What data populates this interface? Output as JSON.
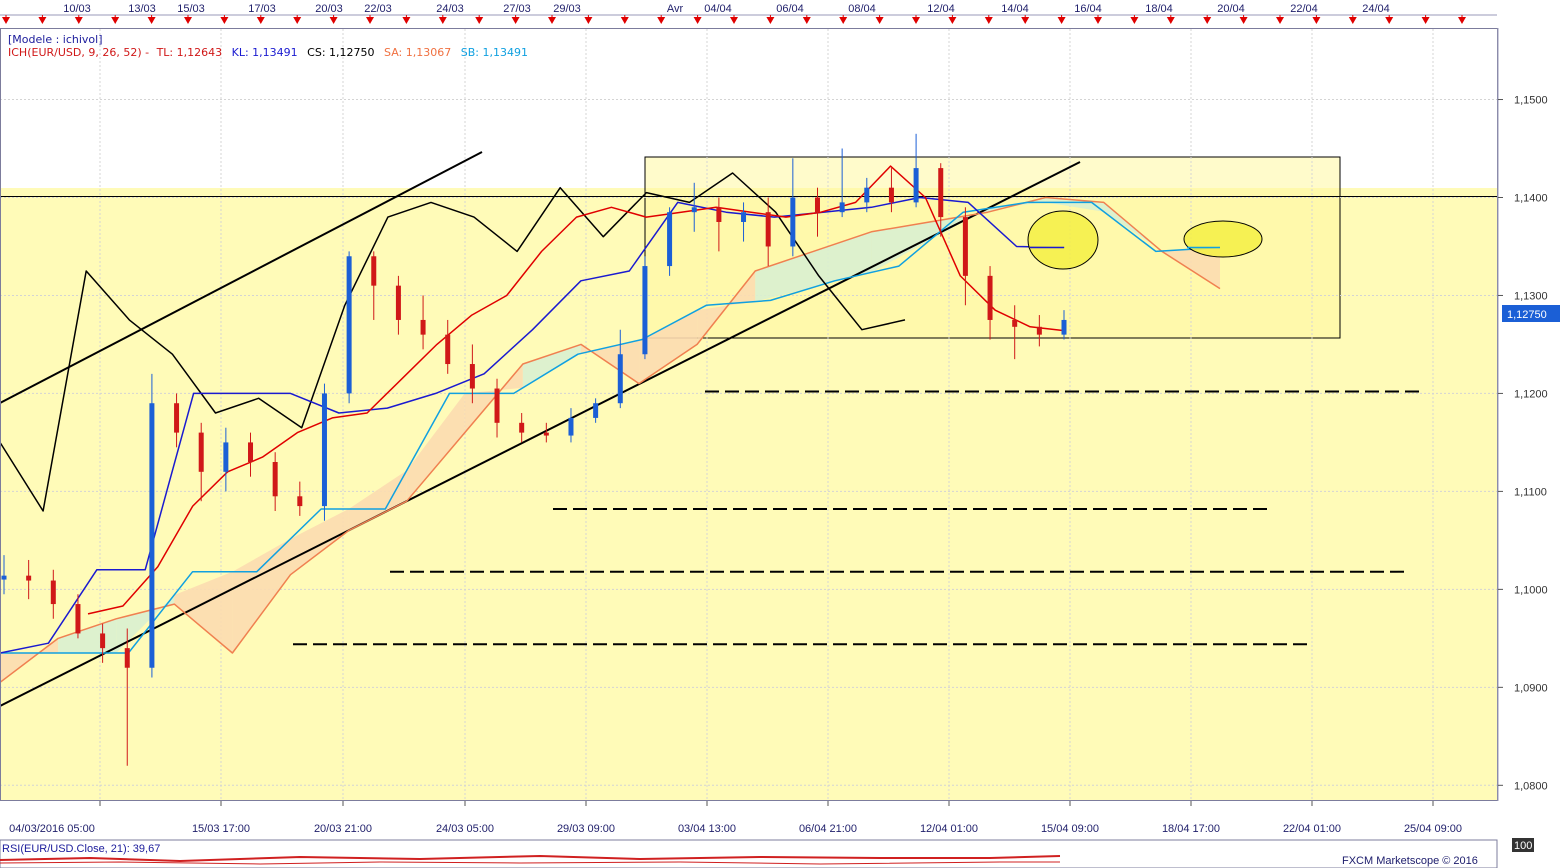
{
  "colors": {
    "tl": "#e00000",
    "kl": "#1a1ad0",
    "cs": "#000000",
    "sa": "#f08050",
    "sb": "#10a0e0",
    "bull": "#1b5fd6",
    "bear": "#d01818",
    "zone": "#fffbb8",
    "cloud_bull": "#d9f0d0",
    "cloud_bear": "#fcdcb0",
    "event": "#e00000",
    "frame": "#4a4a8a"
  },
  "header": {
    "model": "[Modele : ichivol]",
    "ind_name": "ICH(EUR/USD, 9, 26, 52) -",
    "tl": "TL: 1,12643",
    "kl": "KL: 1,13491",
    "cs": "CS: 1,12750",
    "sa": "SA: 1,13067",
    "sb": "SB: 1,13491"
  },
  "rsi": {
    "label": "RSI(EUR/USD.Close, 21): 39,67",
    "scale_top": "100"
  },
  "footer": {
    "brand": "FXCM Marketscope © 2016"
  },
  "last_price": "1,12750",
  "chart_data": {
    "type": "candlestick",
    "instrument": "EUR/USD",
    "ylim": [
      1.0785,
      1.1573
    ],
    "y_ticks": [
      "1,1500",
      "1,1400",
      "1,1300",
      "1,1200",
      "1,1100",
      "1,1000",
      "1,0900",
      "1,0800"
    ],
    "y_tick_values": [
      1.15,
      1.14,
      1.13,
      1.12,
      1.11,
      1.1,
      1.09,
      1.08
    ],
    "x_top_labels": [
      "10/03",
      "13/03",
      "15/03",
      "17/03",
      "20/03",
      "22/03",
      "24/03",
      "27/03",
      "29/03",
      "Avr",
      "04/04",
      "06/04",
      "08/04",
      "12/04",
      "14/04",
      "16/04",
      "18/04",
      "20/04",
      "22/04",
      "24/04"
    ],
    "x_bottom_labels": [
      "04/03/2016 05:00",
      "15/03 17:00",
      "20/03 21:00",
      "24/03 05:00",
      "29/03 09:00",
      "03/04 13:00",
      "06/04 21:00",
      "12/04 01:00",
      "15/04 09:00",
      "18/04 17:00",
      "22/04 01:00",
      "25/04 09:00"
    ],
    "horizontal_levels": [
      1.1202,
      1.1082,
      1.1018,
      1.0944
    ],
    "resistance_line": 1.1401,
    "series": [
      {
        "name": "TL",
        "values": [
          1.0975,
          1.0983,
          1.1023,
          1.1085,
          1.112,
          1.1135,
          1.116,
          1.1175,
          1.118,
          1.1215,
          1.125,
          1.128,
          1.13,
          1.1345,
          1.138,
          1.139,
          1.138,
          1.1385,
          1.139,
          1.1385,
          1.138,
          1.1385,
          1.1395,
          1.1432,
          1.14,
          1.132,
          1.1285,
          1.1268,
          1.1264
        ]
      },
      {
        "name": "KL",
        "values": [
          1.0935,
          1.0945,
          1.102,
          1.102,
          1.12,
          1.12,
          1.12,
          1.118,
          1.1185,
          1.12,
          1.122,
          1.1265,
          1.1315,
          1.1325,
          1.1395,
          1.1385,
          1.138,
          1.1385,
          1.139,
          1.14,
          1.1395,
          1.135,
          1.1349
        ]
      },
      {
        "name": "CS",
        "values": [
          1.115,
          1.108,
          1.1325,
          1.1275,
          1.124,
          1.118,
          1.1195,
          1.1165,
          1.129,
          1.138,
          1.1395,
          1.138,
          1.1345,
          1.141,
          1.136,
          1.1405,
          1.1395,
          1.1425,
          1.1385,
          1.132,
          1.1265,
          1.1275
        ]
      },
      {
        "name": "SA",
        "values": [
          1.0905,
          1.095,
          1.097,
          1.0985,
          1.0935,
          1.1015,
          1.106,
          1.109,
          1.116,
          1.123,
          1.125,
          1.121,
          1.125,
          1.1325,
          1.1345,
          1.1365,
          1.1375,
          1.1385,
          1.14,
          1.1395,
          1.1345,
          1.1307
        ]
      },
      {
        "name": "SB",
        "values": [
          1.0935,
          1.0935,
          1.0935,
          1.1018,
          1.1018,
          1.1082,
          1.1082,
          1.12,
          1.12,
          1.124,
          1.1255,
          1.129,
          1.1295,
          1.1315,
          1.133,
          1.1385,
          1.1395,
          1.1395,
          1.1345,
          1.1349
        ]
      }
    ],
    "candles": [
      [
        1.101,
        1.1014,
        1.1035,
        1.0995
      ],
      [
        1.1014,
        1.1009,
        1.103,
        1.099
      ],
      [
        1.1009,
        1.0985,
        1.102,
        1.097
      ],
      [
        1.0985,
        1.0955,
        1.0995,
        1.095
      ],
      [
        1.0955,
        1.094,
        1.0965,
        1.0925
      ],
      [
        1.094,
        1.092,
        1.096,
        1.082
      ],
      [
        1.092,
        1.119,
        1.122,
        1.091
      ],
      [
        1.119,
        1.116,
        1.12,
        1.1145
      ],
      [
        1.116,
        1.112,
        1.117,
        1.109
      ],
      [
        1.112,
        1.115,
        1.1165,
        1.11
      ],
      [
        1.115,
        1.113,
        1.116,
        1.1115
      ],
      [
        1.113,
        1.1095,
        1.114,
        1.108
      ],
      [
        1.1095,
        1.1085,
        1.111,
        1.1075
      ],
      [
        1.1085,
        1.12,
        1.121,
        1.107
      ],
      [
        1.12,
        1.134,
        1.1345,
        1.119
      ],
      [
        1.134,
        1.131,
        1.1345,
        1.1275
      ],
      [
        1.131,
        1.1275,
        1.132,
        1.126
      ],
      [
        1.1275,
        1.126,
        1.13,
        1.1245
      ],
      [
        1.126,
        1.123,
        1.1275,
        1.122
      ],
      [
        1.123,
        1.1205,
        1.125,
        1.119
      ],
      [
        1.1205,
        1.117,
        1.1215,
        1.1155
      ],
      [
        1.117,
        1.116,
        1.118,
        1.115
      ],
      [
        1.116,
        1.1157,
        1.117,
        1.115
      ],
      [
        1.1157,
        1.1175,
        1.1185,
        1.115
      ],
      [
        1.1175,
        1.119,
        1.1195,
        1.117
      ],
      [
        1.119,
        1.124,
        1.1265,
        1.1185
      ],
      [
        1.124,
        1.133,
        1.134,
        1.1235
      ],
      [
        1.133,
        1.1385,
        1.139,
        1.132
      ],
      [
        1.1385,
        1.139,
        1.1415,
        1.1365
      ],
      [
        1.139,
        1.1375,
        1.14,
        1.1345
      ],
      [
        1.1375,
        1.1385,
        1.1395,
        1.1355
      ],
      [
        1.1385,
        1.135,
        1.14,
        1.133
      ],
      [
        1.135,
        1.14,
        1.144,
        1.134
      ],
      [
        1.14,
        1.1385,
        1.141,
        1.136
      ],
      [
        1.1385,
        1.1395,
        1.145,
        1.138
      ],
      [
        1.1395,
        1.141,
        1.142,
        1.1385
      ],
      [
        1.141,
        1.1395,
        1.143,
        1.1385
      ],
      [
        1.1395,
        1.143,
        1.1465,
        1.139
      ],
      [
        1.143,
        1.138,
        1.1435,
        1.136
      ],
      [
        1.138,
        1.132,
        1.139,
        1.129
      ],
      [
        1.132,
        1.1275,
        1.133,
        1.1255
      ],
      [
        1.1275,
        1.1268,
        1.129,
        1.1235
      ],
      [
        1.1268,
        1.126,
        1.128,
        1.1248
      ],
      [
        1.126,
        1.1275,
        1.1285,
        1.1255
      ]
    ]
  }
}
